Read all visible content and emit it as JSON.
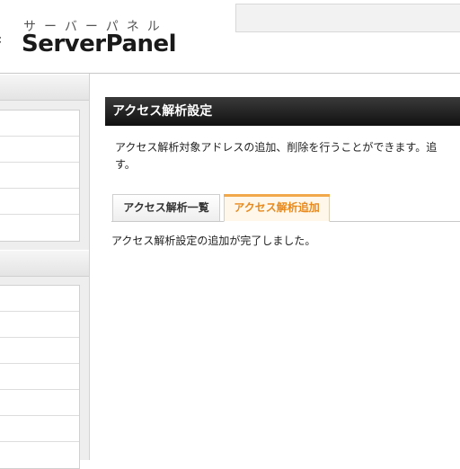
{
  "header": {
    "logo_kana": "サーバーパネル",
    "logo_text": "ServerPanel"
  },
  "sidebar": {
    "sections": [
      {
        "items": [
          "",
          "",
          "",
          "",
          ""
        ]
      },
      {
        "items": [
          "",
          "",
          "",
          "",
          "",
          "",
          ""
        ]
      }
    ]
  },
  "main": {
    "title": "アクセス解析設定",
    "description_line1": "アクセス解析対象アドレスの追加、削除を行うことができます。追",
    "description_line2": "す。",
    "tabs": [
      {
        "label": "アクセス解析一覧",
        "active": false
      },
      {
        "label": "アクセス解析追加",
        "active": true
      }
    ],
    "result_message": "アクセス解析設定の追加が完了しました。"
  },
  "colors": {
    "title_bar": "#1a1a1a",
    "active_tab_text": "#e8891e",
    "active_tab_accent": "#f0a84a"
  }
}
